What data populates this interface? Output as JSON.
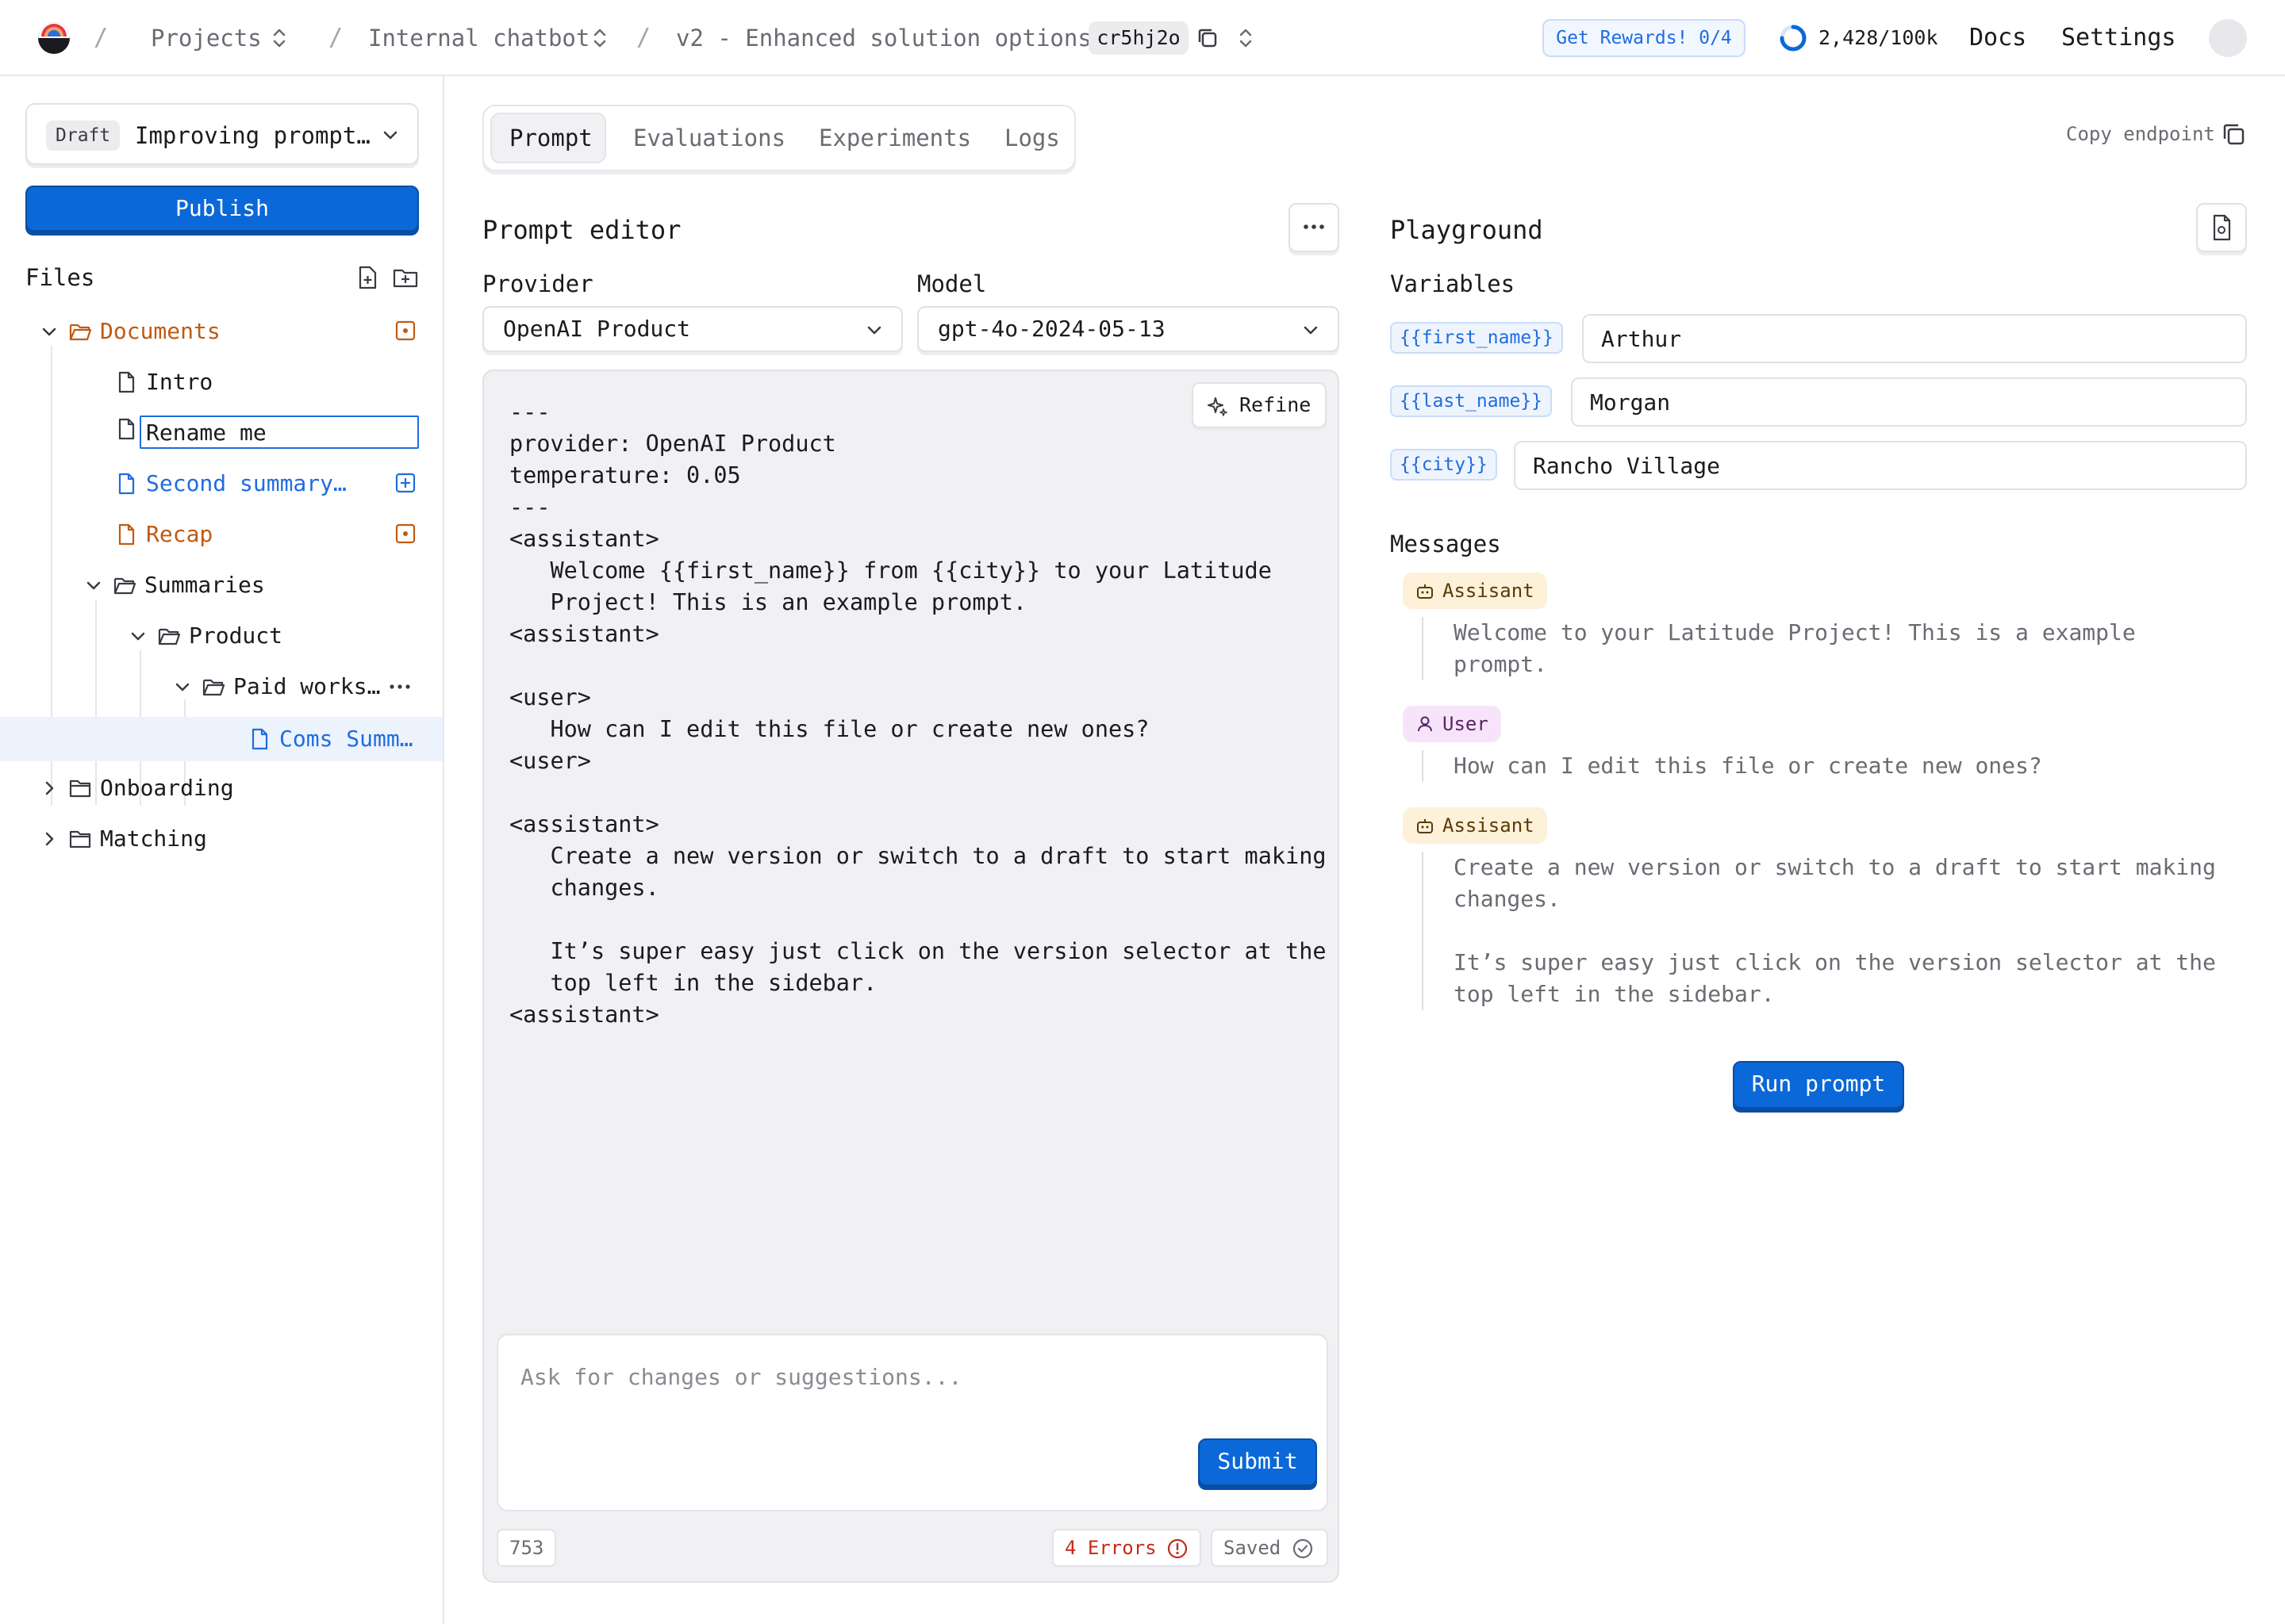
{
  "colors": {
    "accent": "#0b68d8",
    "link": "#1f6ce0",
    "modified": "#c05a13",
    "error": "#c42b1c"
  },
  "breadcrumb": {
    "projects": "Projects",
    "project": "Internal chatbot",
    "version": "v2 - Enhanced solution options",
    "commit_hash": "cr5hj2o"
  },
  "topnav": {
    "rewards": "Get Rewards! 0/4",
    "usage": "2,428/100k",
    "docs": "Docs",
    "settings": "Settings"
  },
  "sidebar": {
    "draft_badge": "Draft",
    "version_name": "Improving prompt…",
    "publish": "Publish",
    "files_title": "Files",
    "tree": {
      "documents": "Documents",
      "intro": "Intro",
      "rename_value": "Rename me",
      "second_summary": "Second summary…",
      "recap": "Recap",
      "summaries": "Summaries",
      "product": "Product",
      "paid_works": "Paid works…",
      "coms_summ": "Coms Summ…",
      "onboarding": "Onboarding",
      "matching": "Matching"
    }
  },
  "tabs": {
    "prompt": "Prompt",
    "evaluations": "Evaluations",
    "experiments": "Experiments",
    "logs": "Logs"
  },
  "copy_endpoint": "Copy endpoint",
  "editor": {
    "title": "Prompt editor",
    "provider_label": "Provider",
    "provider_value": "OpenAI Product",
    "model_label": "Model",
    "model_value": "gpt-4o-2024-05-13",
    "refine": "Refine",
    "code": "---\nprovider: OpenAI Product\ntemperature: 0.05\n---\n<assistant>\n   Welcome {{first_name}} from {{city}} to your Latitude\n   Project! This is an example prompt.\n<assistant>\n\n<user>\n   How can I edit this file or create new ones?\n<user>\n\n<assistant>\n   Create a new version or switch to a draft to start making\n   changes.\n\n   It’s super easy just click on the version selector at the\n   top left in the sidebar.\n<assistant>",
    "ask_placeholder": "Ask for changes or suggestions...",
    "submit": "Submit",
    "token_count": "753",
    "errors": "4 Errors",
    "saved": "Saved"
  },
  "playground": {
    "title": "Playground",
    "variables_title": "Variables",
    "variables": [
      {
        "name": "{{first_name}}",
        "value": "Arthur"
      },
      {
        "name": "{{last_name}}",
        "value": "Morgan"
      },
      {
        "name": "{{city}}",
        "value": "Rancho Village"
      }
    ],
    "messages_title": "Messages",
    "messages": [
      {
        "role": "Assisant",
        "text": "Welcome to your Latitude Project! This is a example\nprompt."
      },
      {
        "role": "User",
        "text": "How can I edit this file or create new ones?"
      },
      {
        "role": "Assisant",
        "text": "Create a new version or switch to a draft to start making\nchanges.\n\nIt’s super easy just click on the version selector at the\ntop left in the sidebar."
      }
    ],
    "run_prompt": "Run prompt"
  }
}
